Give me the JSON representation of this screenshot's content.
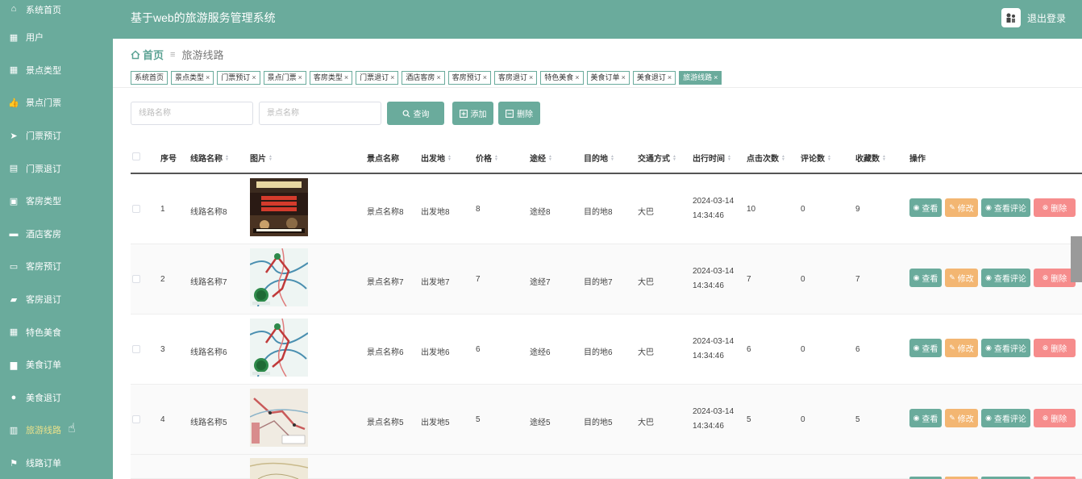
{
  "app": {
    "title": "基于web的旅游服务管理系统",
    "logout_label": "退出登录",
    "accent_color": "#6aab9c"
  },
  "sidebar": {
    "items": [
      {
        "label": "系统首页",
        "icon": "home-icon"
      },
      {
        "label": "用户",
        "icon": "grid-icon"
      },
      {
        "label": "景点类型",
        "icon": "grid-icon"
      },
      {
        "label": "景点门票",
        "icon": "thumb-icon"
      },
      {
        "label": "门票预订",
        "icon": "send-icon"
      },
      {
        "label": "门票退订",
        "icon": "clipboard-icon"
      },
      {
        "label": "客房类型",
        "icon": "calendar-check-icon"
      },
      {
        "label": "酒店客房",
        "icon": "bed-icon"
      },
      {
        "label": "客房预订",
        "icon": "comment-icon"
      },
      {
        "label": "客房退订",
        "icon": "ticket-icon"
      },
      {
        "label": "特色美食",
        "icon": "grid-icon"
      },
      {
        "label": "美食订单",
        "icon": "briefcase-icon"
      },
      {
        "label": "美食退订",
        "icon": "user-icon"
      },
      {
        "label": "旅游线路",
        "icon": "chart-icon"
      },
      {
        "label": "线路订单",
        "icon": "flag-icon"
      }
    ]
  },
  "breadcrumb": {
    "home": "首页",
    "separator": "≡",
    "current": "旅游线路"
  },
  "tags": [
    {
      "label": "系统首页",
      "closable": false
    },
    {
      "label": "景点类型",
      "closable": true
    },
    {
      "label": "门票预订",
      "closable": true
    },
    {
      "label": "景点门票",
      "closable": true
    },
    {
      "label": "客房类型",
      "closable": true
    },
    {
      "label": "门票退订",
      "closable": true
    },
    {
      "label": "酒店客房",
      "closable": true
    },
    {
      "label": "客房预订",
      "closable": true
    },
    {
      "label": "客房退订",
      "closable": true
    },
    {
      "label": "特色美食",
      "closable": true
    },
    {
      "label": "美食订单",
      "closable": true
    },
    {
      "label": "美食退订",
      "closable": true
    },
    {
      "label": "旅游线路",
      "closable": true,
      "active": true
    }
  ],
  "search": {
    "route_placeholder": "线路名称",
    "spot_placeholder": "景点名称",
    "query_label": "查询",
    "add_label": "添加",
    "delete_label": "删除"
  },
  "table": {
    "columns": [
      "序号",
      "线路名称",
      "图片",
      "景点名称",
      "出发地",
      "价格",
      "途经",
      "目的地",
      "交通方式",
      "出行时间",
      "点击次数",
      "评论数",
      "收藏数",
      "操作"
    ],
    "action_labels": {
      "view": "查看",
      "edit": "修改",
      "comments": "查看评论",
      "delete": "删除"
    },
    "rows": [
      {
        "index": "1",
        "route": "线路名称8",
        "spot": "景点名称8",
        "from": "出发地8",
        "price": "8",
        "via": "途经8",
        "to": "目的地8",
        "transport": "大巴",
        "time": "2024-03-14 14:34:46",
        "clicks": "10",
        "comments": "0",
        "favorites": "9",
        "image": "poster"
      },
      {
        "index": "2",
        "route": "线路名称7",
        "spot": "景点名称7",
        "from": "出发地7",
        "price": "7",
        "via": "途经7",
        "to": "目的地7",
        "transport": "大巴",
        "time": "2024-03-14 14:34:46",
        "clicks": "7",
        "comments": "0",
        "favorites": "7",
        "image": "map"
      },
      {
        "index": "3",
        "route": "线路名称6",
        "spot": "景点名称6",
        "from": "出发地6",
        "price": "6",
        "via": "途经6",
        "to": "目的地6",
        "transport": "大巴",
        "time": "2024-03-14 14:34:46",
        "clicks": "6",
        "comments": "0",
        "favorites": "6",
        "image": "map"
      },
      {
        "index": "4",
        "route": "线路名称5",
        "spot": "景点名称5",
        "from": "出发地5",
        "price": "5",
        "via": "途经5",
        "to": "目的地5",
        "transport": "大巴",
        "time": "2024-03-14 14:34:46",
        "clicks": "5",
        "comments": "0",
        "favorites": "5",
        "image": "route-map"
      }
    ]
  }
}
